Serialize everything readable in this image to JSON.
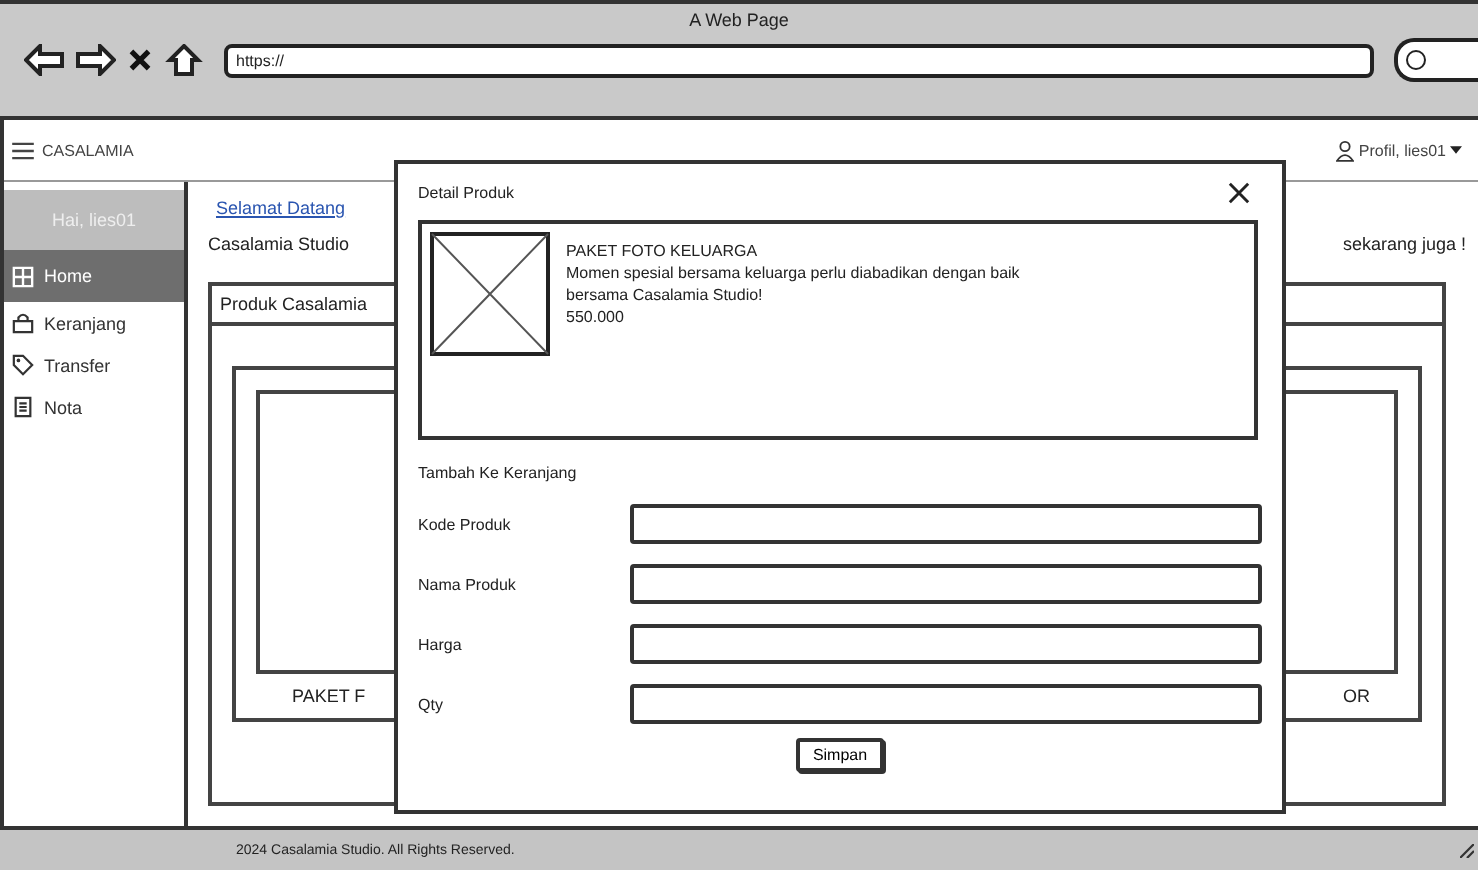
{
  "browser": {
    "title": "A Web Page",
    "url": "https://"
  },
  "navbar": {
    "brand": "CASALAMIA",
    "profile": "Profil, lies01"
  },
  "sidebar": {
    "greeting": "Hai, lies01",
    "items": [
      {
        "label": "Home",
        "selected": true
      },
      {
        "label": "Keranjang",
        "selected": false
      },
      {
        "label": "Transfer",
        "selected": false
      },
      {
        "label": "Nota",
        "selected": false
      }
    ]
  },
  "content": {
    "welcome": "Selamat Datang",
    "intro": "Casalamia Studio",
    "intro_end": "sekarang juga !",
    "panel_title": "Produk Casalamia",
    "cards": [
      {
        "caption": "PAKET F"
      },
      {
        "caption": "OR"
      }
    ]
  },
  "dialog": {
    "title": "Detail Produk",
    "product": {
      "name": "PAKET FOTO KELUARGA",
      "description": "Momen spesial bersama keluarga perlu diabadikan dengan baik bersama Casalamia Studio!",
      "price": "550.000"
    },
    "section": "Tambah Ke Keranjang",
    "fields": [
      {
        "label": "Kode Produk"
      },
      {
        "label": "Nama Produk"
      },
      {
        "label": "Harga"
      },
      {
        "label": "Qty"
      }
    ],
    "submit": "Simpan"
  },
  "footer": "2024 Casalamia Studio. All Rights Reserved."
}
